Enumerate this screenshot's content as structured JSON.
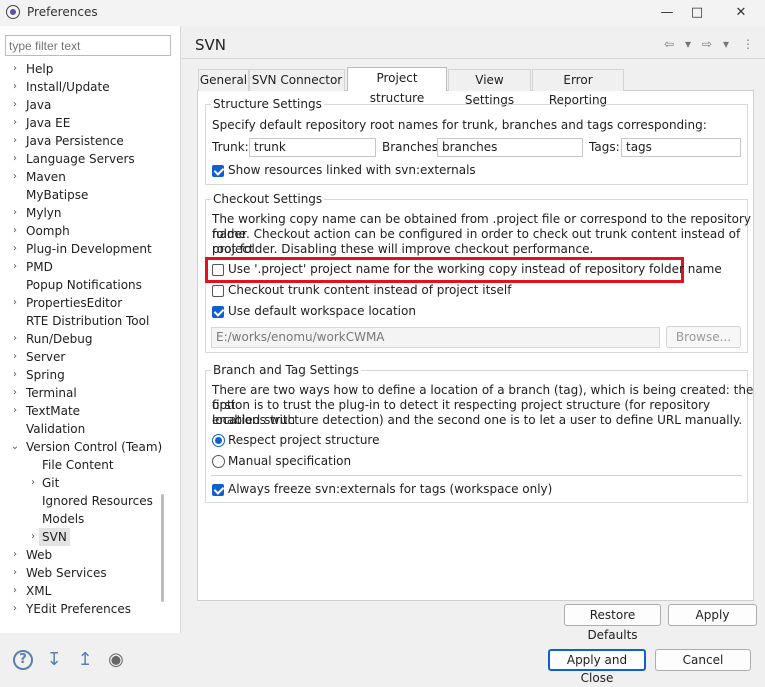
{
  "window": {
    "title": "Preferences",
    "minimize": "—",
    "maximize": "□",
    "close": "✕"
  },
  "filter": {
    "placeholder": "type filter text"
  },
  "tree": [
    {
      "label": "Help",
      "indent": 0,
      "twistie": "›"
    },
    {
      "label": "Install/Update",
      "indent": 0,
      "twistie": "›"
    },
    {
      "label": "Java",
      "indent": 0,
      "twistie": "›"
    },
    {
      "label": "Java EE",
      "indent": 0,
      "twistie": "›"
    },
    {
      "label": "Java Persistence",
      "indent": 0,
      "twistie": "›"
    },
    {
      "label": "Language Servers",
      "indent": 0,
      "twistie": "›"
    },
    {
      "label": "Maven",
      "indent": 0,
      "twistie": "›"
    },
    {
      "label": "MyBatipse",
      "indent": 0,
      "twistie": ""
    },
    {
      "label": "Mylyn",
      "indent": 0,
      "twistie": "›"
    },
    {
      "label": "Oomph",
      "indent": 0,
      "twistie": "›"
    },
    {
      "label": "Plug-in Development",
      "indent": 0,
      "twistie": "›"
    },
    {
      "label": "PMD",
      "indent": 0,
      "twistie": "›"
    },
    {
      "label": "Popup Notifications",
      "indent": 0,
      "twistie": ""
    },
    {
      "label": "PropertiesEditor",
      "indent": 0,
      "twistie": "›"
    },
    {
      "label": "RTE Distribution Tool",
      "indent": 0,
      "twistie": ""
    },
    {
      "label": "Run/Debug",
      "indent": 0,
      "twistie": "›"
    },
    {
      "label": "Server",
      "indent": 0,
      "twistie": "›"
    },
    {
      "label": "Spring",
      "indent": 0,
      "twistie": "›"
    },
    {
      "label": "Terminal",
      "indent": 0,
      "twistie": "›"
    },
    {
      "label": "TextMate",
      "indent": 0,
      "twistie": "›"
    },
    {
      "label": "Validation",
      "indent": 0,
      "twistie": ""
    },
    {
      "label": "Version Control (Team)",
      "indent": 0,
      "twistie": "⌄"
    },
    {
      "label": "File Content",
      "indent": 1,
      "twistie": ""
    },
    {
      "label": "Git",
      "indent": 1,
      "twistie": "›"
    },
    {
      "label": "Ignored Resources",
      "indent": 1,
      "twistie": ""
    },
    {
      "label": "Models",
      "indent": 1,
      "twistie": ""
    },
    {
      "label": "SVN",
      "indent": 1,
      "twistie": "›",
      "selected": true
    },
    {
      "label": "Web",
      "indent": 0,
      "twistie": "›"
    },
    {
      "label": "Web Services",
      "indent": 0,
      "twistie": "›"
    },
    {
      "label": "XML",
      "indent": 0,
      "twistie": "›"
    },
    {
      "label": "YEdit Preferences",
      "indent": 0,
      "twistie": "›"
    }
  ],
  "page": {
    "title": "SVN",
    "back": "⇦",
    "forward": "⇨",
    "dropdown": "▾",
    "menu": "⋮"
  },
  "tabs": [
    "General",
    "SVN Connector",
    "Project structure",
    "View Settings",
    "Error Reporting"
  ],
  "structure": {
    "title": "Structure Settings",
    "description": "Specify default repository root names for trunk, branches and tags corresponding:",
    "trunk_label": "Trunk:",
    "trunk_value": "trunk",
    "branches_label": "Branches:",
    "branches_value": "branches",
    "tags_label": "Tags:",
    "tags_value": "tags",
    "externals_label": "Show resources linked with svn:externals"
  },
  "checkout": {
    "title": "Checkout Settings",
    "desc_line1": "The working copy name can be obtained from .project file or correspond to the repository folder",
    "desc_line2": "name. Checkout action can be configured in order to check out trunk content instead of project",
    "desc_line3": "root folder. Disabling these will improve checkout performance.",
    "use_project_name": "Use '.project' project name for the working copy instead of repository folder name",
    "checkout_trunk": "Checkout trunk content instead of project itself",
    "use_default_location": "Use default workspace location",
    "location_value": "E:/works/enomu/workCWMA",
    "browse": "Browse..."
  },
  "branch": {
    "title": "Branch and Tag Settings",
    "desc_line1": "There are two ways how to define a location of a branch (tag), which is being created: the first",
    "desc_line2": "option is to trust the plug-in to detect it respecting project structure (for repository locations with",
    "desc_line3": "enabled structure detection) and the second one is to let a user to define URL manually.",
    "respect": "Respect project structure",
    "manual": "Manual specification",
    "freeze": "Always freeze svn:externals for tags (workspace only)"
  },
  "buttons": {
    "restore": "Restore Defaults",
    "apply": "Apply",
    "apply_close": "Apply and Close",
    "cancel": "Cancel"
  },
  "footer_icons": {
    "help": "?",
    "import": "↧",
    "export": "↥",
    "record": "◉"
  },
  "colors": {
    "accent": "#0f5fd1",
    "highlight": "#e3101f"
  }
}
